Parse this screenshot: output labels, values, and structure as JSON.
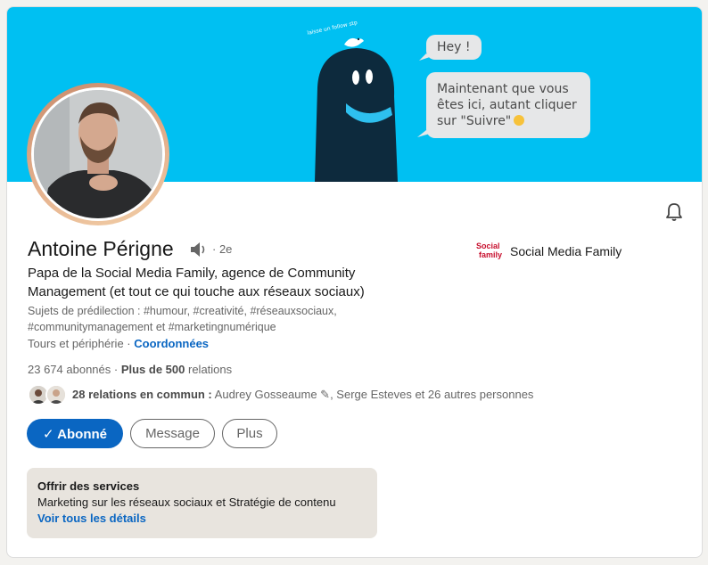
{
  "banner": {
    "bubble_hey": "Hey !",
    "bubble_main": "Maintenant que vous\nêtes ici, autant cliquer\nsur \"Suivre\"",
    "bird_caption": "laisse un follow stp",
    "background_color": "#00c0f2"
  },
  "profile": {
    "name": "Antoine Périgne",
    "degree": "· 2e",
    "headline": "Papa de la Social Media Family, agence de Community Management (et tout ce qui touche aux réseaux sociaux)",
    "topics": "Sujets de prédilection : #humour, #creativité, #réseauxsociaux, #communitymanagement et #marketingnumérique",
    "location": "Tours et périphérie ·",
    "contact_link": "Coordonnées",
    "followers": "23 674 abonnés",
    "connections": "Plus de 500",
    "connections_suffix": "relations",
    "mutual_bold": "28 relations en commun :",
    "mutual_rest": "Audrey Gosseaume ✎, Serge Esteves et 26 autres personnes"
  },
  "company": {
    "logo_line1": "Social",
    "logo_line2": "family",
    "name": "Social Media Family"
  },
  "actions": {
    "follow_label": "✓ Abonné",
    "message_label": "Message",
    "more_label": "Plus"
  },
  "services": {
    "title": "Offrir des services",
    "description": "Marketing sur les réseaux sociaux et Stratégie de contenu",
    "link": "Voir tous les détails"
  },
  "colors": {
    "accent": "#0a66c2",
    "banner": "#00c0f2",
    "services_bg": "#e8e4de"
  }
}
